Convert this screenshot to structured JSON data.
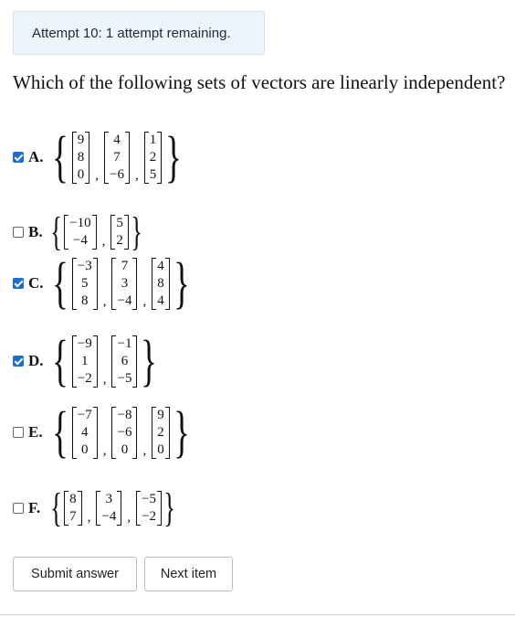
{
  "attempt_banner": "Attempt 10: 1 attempt remaining.",
  "question": "Which of the following sets of vectors are linearly independent?",
  "options": [
    {
      "label": "A.",
      "checked": true,
      "vectors": [
        [
          "9",
          "8",
          "0"
        ],
        [
          "4",
          "7",
          "−6"
        ],
        [
          "1",
          "2",
          "5"
        ]
      ]
    },
    {
      "label": "B.",
      "checked": false,
      "vectors": [
        [
          "−10",
          "−4"
        ],
        [
          "5",
          "2"
        ]
      ]
    },
    {
      "label": "C.",
      "checked": true,
      "vectors": [
        [
          "−3",
          "5",
          "8"
        ],
        [
          "7",
          "3",
          "−4"
        ],
        [
          "4",
          "8",
          "4"
        ]
      ]
    },
    {
      "label": "D.",
      "checked": true,
      "vectors": [
        [
          "−9",
          "1",
          "−2"
        ],
        [
          "−1",
          "6",
          "−5"
        ]
      ]
    },
    {
      "label": "E.",
      "checked": false,
      "vectors": [
        [
          "−7",
          "4",
          "0"
        ],
        [
          "−8",
          "−6",
          "0"
        ],
        [
          "9",
          "2",
          "0"
        ]
      ]
    },
    {
      "label": "F.",
      "checked": false,
      "vectors": [
        [
          "8",
          "7"
        ],
        [
          "3",
          "−4"
        ],
        [
          "−5",
          "−2"
        ]
      ]
    }
  ],
  "buttons": {
    "submit": "Submit answer",
    "next": "Next item"
  },
  "colors": {
    "checkbox_checked": "#1c6dd0",
    "banner_bg": "#eef4fb",
    "banner_border": "#cfe0f1"
  }
}
